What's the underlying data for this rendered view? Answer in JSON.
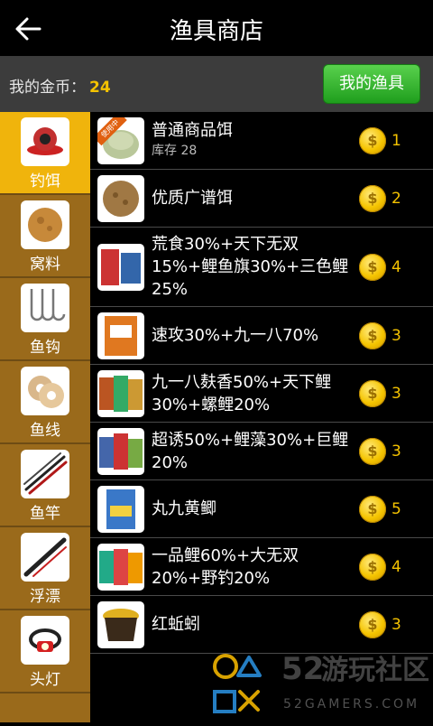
{
  "header": {
    "title": "渔具商店",
    "back_icon": "back-arrow-icon"
  },
  "coins": {
    "label": "我的金币：",
    "value": "24"
  },
  "my_gear_button": "我的渔具",
  "categories": [
    {
      "label": "钓饵",
      "icon": "bait-icon",
      "active": true
    },
    {
      "label": "窝料",
      "icon": "groundbait-icon",
      "active": false
    },
    {
      "label": "鱼钩",
      "icon": "hook-icon",
      "active": false
    },
    {
      "label": "鱼线",
      "icon": "line-spool-icon",
      "active": false
    },
    {
      "label": "鱼竿",
      "icon": "rod-icon",
      "active": false
    },
    {
      "label": "浮漂",
      "icon": "float-icon",
      "active": false
    },
    {
      "label": "头灯",
      "icon": "headlamp-icon",
      "active": false
    }
  ],
  "items": [
    {
      "name": "普通商品饵",
      "stock": "库存 28",
      "badge": "使用中",
      "price": "1"
    },
    {
      "name": "优质广谱饵",
      "price": "2"
    },
    {
      "name": "荒食30%+天下无双15%+鲤鱼旗30%+三色鲤25%",
      "price": "4"
    },
    {
      "name": "速攻30%+九一八70%",
      "price": "3"
    },
    {
      "name": "九一八麸香50%+天下鲤30%+螺鲤20%",
      "price": "3"
    },
    {
      "name": "超诱50%+鲤藻30%+巨鲤20%",
      "price": "3"
    },
    {
      "name": "丸九黄鲫",
      "price": "5"
    },
    {
      "name": "一品鲤60%+大无双20%+野钓20%",
      "price": "4"
    },
    {
      "name": "红蚯蚓",
      "price": "3"
    }
  ],
  "coin_symbol": "$",
  "watermark": {
    "number": "52",
    "text": "游玩社区",
    "site": "52GAMERS.COM"
  }
}
